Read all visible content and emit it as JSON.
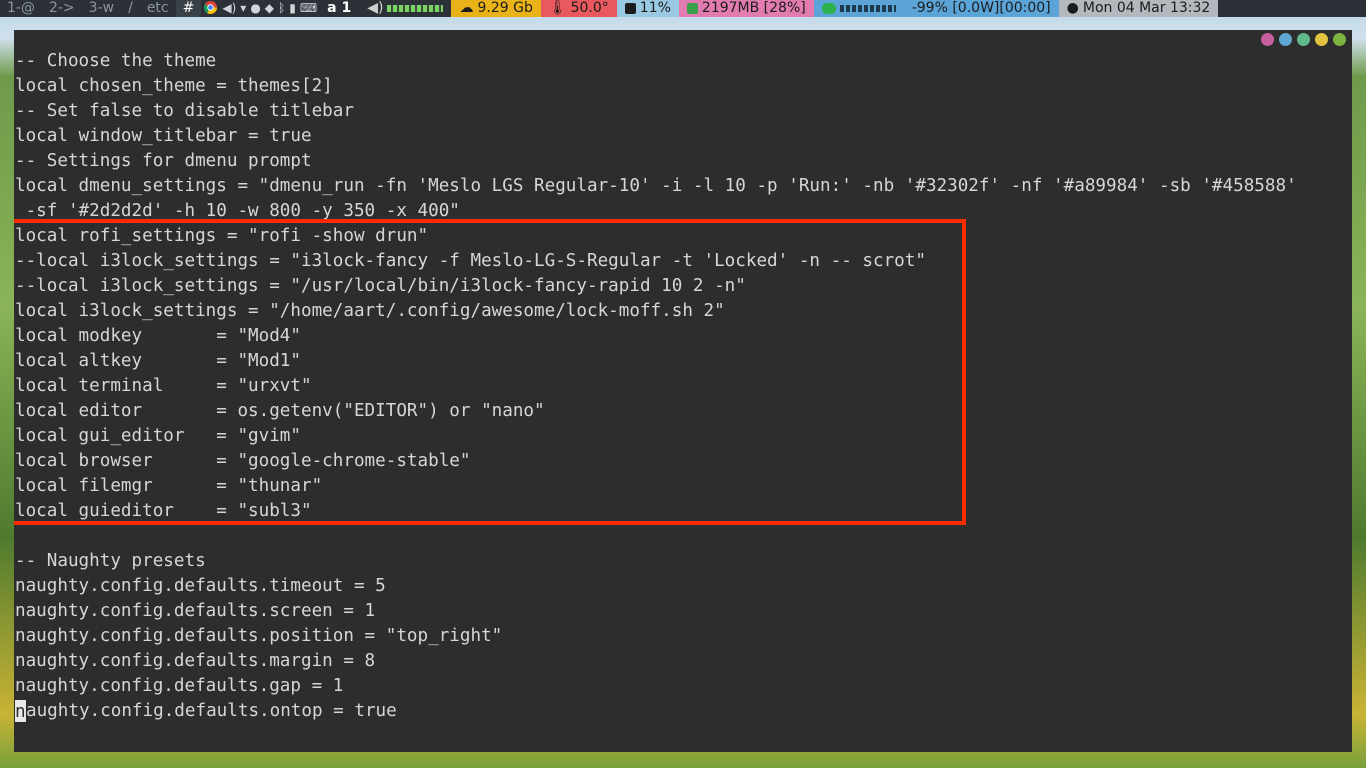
{
  "topbar": {
    "tags": [
      "1-@",
      "2->",
      "3-w",
      "/",
      "etc",
      "#"
    ],
    "active_tag": "#",
    "keyboard_layout": "a 1",
    "storage": "9.29 Gb",
    "temperature": "50.0°",
    "cpu": "11%",
    "memory": "2197MB [28%]",
    "battery": "-99% [0.0W][00:00]",
    "clock": "Mon 04 Mar  13:32",
    "icons": [
      "chrome-icon",
      "volume-icon",
      "wifi-icon",
      "location-icon",
      "shield-icon",
      "bluetooth-icon",
      "battery-icon",
      "keyboard-icon",
      "cloud-icon",
      "thermometer-icon",
      "cpu-icon",
      "memory-icon",
      "battery-bar-icon",
      "clock-icon"
    ]
  },
  "terminal": {
    "titlebar_dots": [
      "#c6609e",
      "#5fa8d3",
      "#5fb98b",
      "#e2c241",
      "#7cb342"
    ],
    "lines": [
      "-- Choose the theme",
      "local chosen_theme = themes[2]",
      "-- Set false to disable titlebar",
      "local window_titlebar = true",
      "-- Settings for dmenu prompt",
      "local dmenu_settings = \"dmenu_run -fn 'Meslo LGS Regular-10' -i -l 10 -p 'Run:' -nb '#32302f' -nf '#a89984' -sb '#458588'",
      " -sf '#2d2d2d' -h 10 -w 800 -y 350 -x 400\"",
      "local rofi_settings = \"rofi -show drun\"",
      "--local i3lock_settings = \"i3lock-fancy -f Meslo-LG-S-Regular -t 'Locked' -n -- scrot\"",
      "--local i3lock_settings = \"/usr/local/bin/i3lock-fancy-rapid 10 2 -n\"",
      "local i3lock_settings = \"/home/aart/.config/awesome/lock-moff.sh 2\"",
      "local modkey       = \"Mod4\"",
      "local altkey       = \"Mod1\"",
      "local terminal     = \"urxvt\"",
      "local editor       = os.getenv(\"EDITOR\") or \"nano\"",
      "local gui_editor   = \"gvim\"",
      "local browser      = \"google-chrome-stable\"",
      "local filemgr      = \"thunar\"",
      "local guieditor    = \"subl3\"",
      "",
      "-- Naughty presets",
      "naughty.config.defaults.timeout = 5",
      "naughty.config.defaults.screen = 1",
      "naughty.config.defaults.position = \"top_right\"",
      "naughty.config.defaults.margin = 8",
      "naughty.config.defaults.gap = 1"
    ],
    "cursor_line_char": "n",
    "cursor_line_rest": "aughty.config.defaults.ontop = true"
  },
  "colors": {
    "terminal_bg": "#2d2d2d",
    "terminal_fg": "#d6d6d6",
    "highlight_border": "#ff2a00"
  }
}
